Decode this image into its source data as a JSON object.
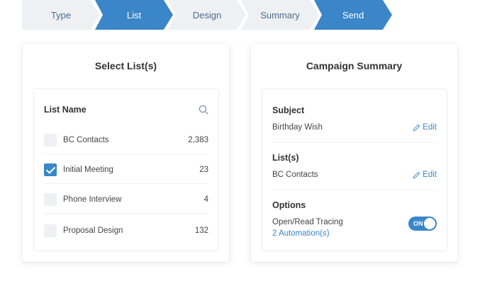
{
  "stepper": {
    "steps": [
      {
        "label": "Type",
        "active": false
      },
      {
        "label": "List",
        "active": true
      },
      {
        "label": "Design",
        "active": false
      },
      {
        "label": "Summary",
        "active": false
      },
      {
        "label": "Send",
        "active": true
      }
    ]
  },
  "select_lists": {
    "title": "Select List(s)",
    "column_header": "List Name",
    "search_icon": "search-icon",
    "items": [
      {
        "name": "BC Contacts",
        "count": "2,383",
        "checked": false
      },
      {
        "name": "Initial Meeting",
        "count": "23",
        "checked": true
      },
      {
        "name": "Phone Interview",
        "count": "4",
        "checked": false
      },
      {
        "name": "Proposal Design",
        "count": "132",
        "checked": false
      }
    ]
  },
  "campaign_summary": {
    "title": "Campaign Summary",
    "subject": {
      "heading": "Subject",
      "value": "Birthday Wish",
      "edit_label": "Edit"
    },
    "lists": {
      "heading": "List(s)",
      "value": "BC Contacts",
      "edit_label": "Edit"
    },
    "options": {
      "heading": "Options",
      "tracing_label": "Open/Read Tracing",
      "automations_link": "2 Automation(s)",
      "toggle_label": "ON",
      "toggle_on": true
    }
  },
  "colors": {
    "accent": "#3a86c8",
    "inactive_step": "#eef0f3"
  }
}
